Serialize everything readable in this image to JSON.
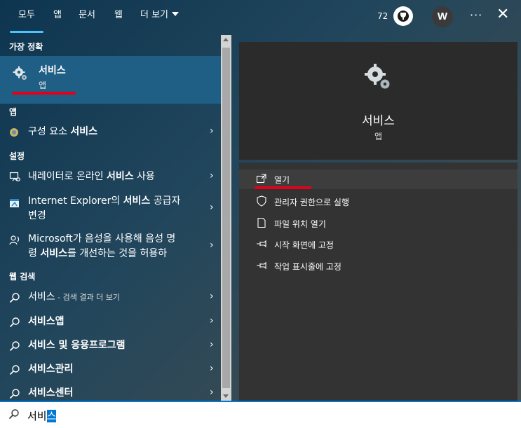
{
  "tabs": [
    "모두",
    "앱",
    "문서",
    "웹",
    "더 보기"
  ],
  "header": {
    "points": "72",
    "avatar_initial": "W",
    "more": "···",
    "close": "✕"
  },
  "sections": {
    "best_match": "가장 정확",
    "apps": "앱",
    "settings": "설정",
    "web": "웹 검색"
  },
  "best_match": {
    "name": "서비스",
    "type": "앱",
    "icon": "gears-icon"
  },
  "apps": [
    {
      "pre": "구성 요소 ",
      "bold": "서비스",
      "icon": "component-services-icon"
    }
  ],
  "settings": [
    {
      "pre": "내레이터로 온라인 ",
      "bold": "서비스",
      "post": " 사용",
      "icon": "narrator-icon"
    },
    {
      "line1_pre": "Internet Explorer의 ",
      "line1_bold": "서비스",
      "line1_post": " 공급자",
      "line2": "변경",
      "icon": "ie-settings-icon"
    },
    {
      "line1": "Microsoft가 음성을 사용해 음성 명",
      "line2_pre": "령 ",
      "line2_bold": "서비스",
      "line2_post": "를 개선하는 것을 허용하",
      "icon": "speech-icon"
    }
  ],
  "web": [
    {
      "bold": "서비스",
      "suffix": " - 검색 결과 더 보기"
    },
    {
      "bold": "서비스앱"
    },
    {
      "bold": "서비스 및 응용프로그램"
    },
    {
      "bold": "서비스관리"
    },
    {
      "bold": "서비스센터"
    }
  ],
  "chevron": "›",
  "preview": {
    "title": "서비스",
    "type": "앱"
  },
  "actions": [
    {
      "label": "열기",
      "icon": "open-icon"
    },
    {
      "label": "관리자 권한으로 실행",
      "icon": "shield-icon"
    },
    {
      "label": "파일 위치 열기",
      "icon": "file-location-icon"
    },
    {
      "label": "시작 화면에 고정",
      "icon": "pin-icon"
    },
    {
      "label": "작업 표시줄에 고정",
      "icon": "pin-taskbar-icon"
    }
  ],
  "search": {
    "typed": "서비",
    "selected": "스"
  },
  "colors": {
    "accent": "#4cc2ff",
    "selection": "#0078d4",
    "highlight_line": "#e5001a"
  }
}
